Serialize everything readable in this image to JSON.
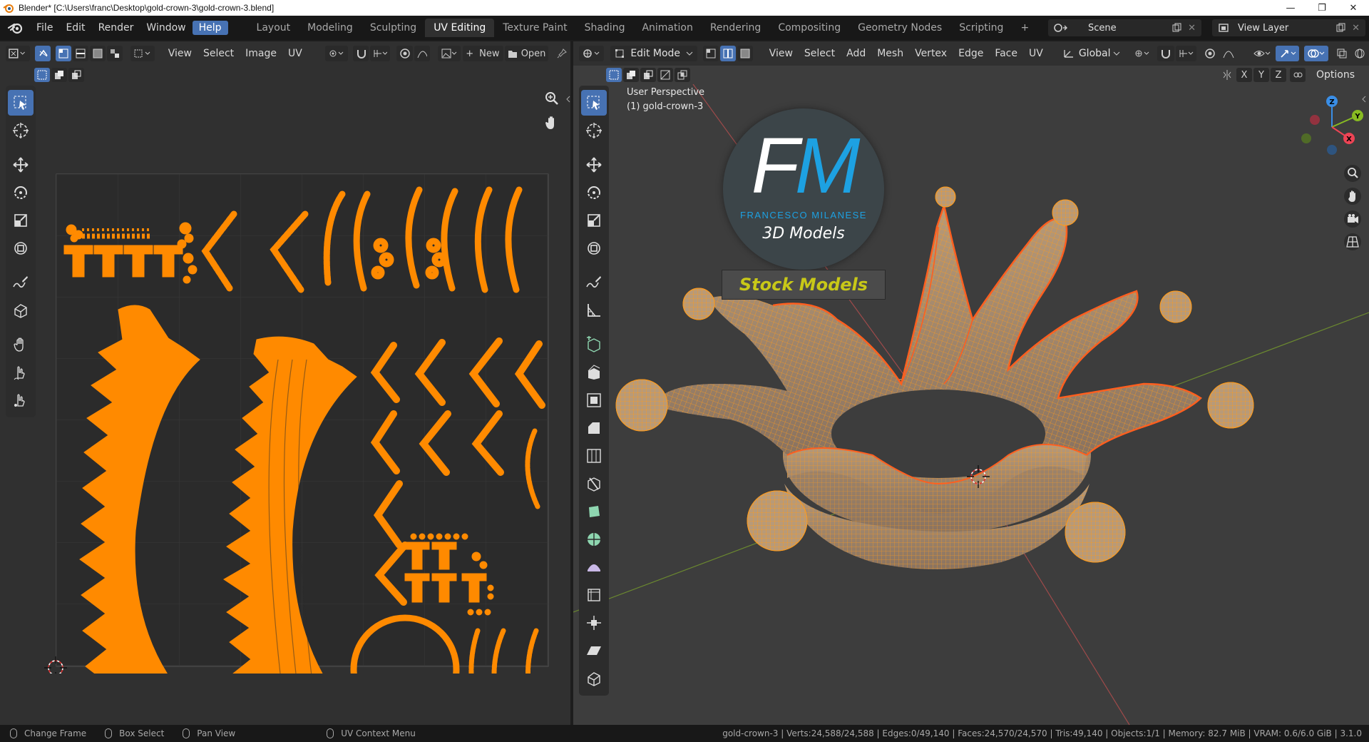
{
  "window": {
    "title": "Blender* [C:\\Users\\franc\\Desktop\\gold-crown-3\\gold-crown-3.blend]",
    "controls": [
      "—",
      "❐",
      "✕"
    ]
  },
  "menu": {
    "items": [
      "File",
      "Edit",
      "Render",
      "Window",
      "Help"
    ],
    "active": "Help"
  },
  "workspaces": {
    "tabs": [
      "Layout",
      "Modeling",
      "Sculpting",
      "UV Editing",
      "Texture Paint",
      "Shading",
      "Animation",
      "Rendering",
      "Compositing",
      "Geometry Nodes",
      "Scripting"
    ],
    "active": "UV Editing",
    "add": "+"
  },
  "scene": {
    "label": "Scene",
    "view_layer": "View Layer"
  },
  "uv_editor": {
    "menus": [
      "View",
      "Select",
      "Image",
      "UV"
    ],
    "new_label": "New",
    "open_label": "Open"
  },
  "viewport": {
    "mode": "Edit Mode",
    "menus": [
      "View",
      "Select",
      "Add",
      "Mesh",
      "Vertex",
      "Edge",
      "Face",
      "UV"
    ],
    "orientation": "Global",
    "axes": [
      "X",
      "Y",
      "Z"
    ],
    "options_label": "Options",
    "perspective": "User Perspective",
    "object": "(1) gold-crown-3",
    "gizmo": {
      "x": "X",
      "y": "Y",
      "z": "Z"
    }
  },
  "watermark": {
    "logo": "FM",
    "name": "FRANCESCO MILANESE",
    "tagline": "3D Models",
    "ribbon": "Stock Models"
  },
  "statusbar": {
    "items": [
      "Change Frame",
      "Box Select",
      "Pan View",
      "UV Context Menu"
    ],
    "stats": "gold-crown-3 | Verts:24,588/24,588 | Edges:0/49,140 | Faces:24,570/24,570 | Tris:49,140 | Objects:1/1 | Memory: 82.7 MiB | VRAM: 0.6/6.0 GiB | 3.1.0"
  },
  "colors": {
    "accent": "#4772b3",
    "uv_island": "#ff8a00",
    "mesh_wire": "#ff9b1a",
    "mesh_edge": "#ff5f1f",
    "x_axis": "#ee4455",
    "y_axis": "#88bb22",
    "z_axis": "#3a8ee6"
  }
}
